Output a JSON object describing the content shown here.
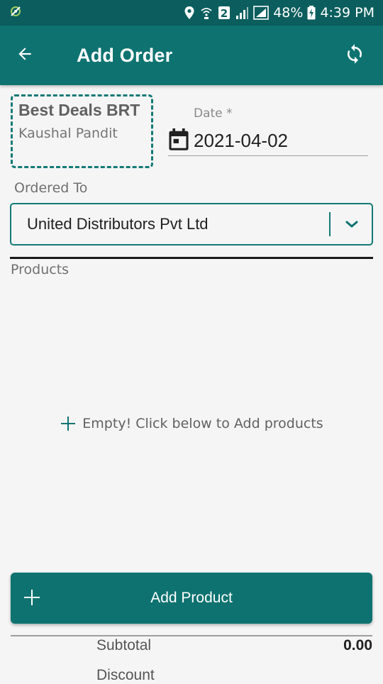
{
  "status_bar": {
    "battery": "48%",
    "time": "4:39 PM",
    "sim_badge": "2",
    "icons": [
      "app-notification-icon",
      "location-icon",
      "wifi-calling-icon",
      "sim-2-icon",
      "signal-icon",
      "signal-r-icon",
      "battery-charging-icon"
    ]
  },
  "app_bar": {
    "title": "Add Order",
    "back_icon": "arrow-left-icon",
    "refresh_icon": "sync-icon"
  },
  "seller": {
    "name": "Best Deals BRT",
    "contact": "Kaushal Pandit"
  },
  "date_field": {
    "label": "Date *",
    "value": "2021-04-02",
    "icon": "calendar-icon"
  },
  "ordered_to": {
    "label": "Ordered To",
    "value": "United Distributors Pvt Ltd",
    "icon": "chevron-down-icon"
  },
  "products": {
    "label": "Products",
    "empty_message": "Empty! Click below to Add products",
    "icon": "plus-icon"
  },
  "add_product": {
    "label": "Add Product",
    "icon": "plus-icon"
  },
  "summary": {
    "subtotal_label": "Subtotal",
    "subtotal_value": "0.00",
    "discount_label": "Discount"
  },
  "colors": {
    "primary": "#0e7370",
    "status_bar": "#0b5e5d",
    "accent": "#147a76",
    "background": "#f5f5f5"
  }
}
